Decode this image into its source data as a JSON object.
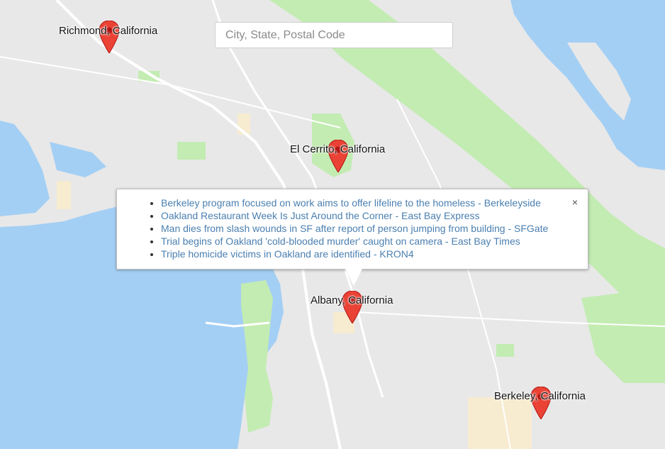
{
  "search": {
    "placeholder": "City, State, Postal Code",
    "value": ""
  },
  "markers": [
    {
      "label": "Richmond, California"
    },
    {
      "label": "El Cerrito, California"
    },
    {
      "label": "Albany, California"
    },
    {
      "label": "Berkeley, California"
    }
  ],
  "popup": {
    "close_label": "×",
    "items": [
      {
        "text": "Berkeley program focused on work aims to offer lifeline to the homeless - Berkeleyside"
      },
      {
        "text": "Oakland Restaurant Week Is Just Around the Corner - East Bay Express"
      },
      {
        "text": "Man dies from slash wounds in SF after report of person jumping from building - SFGate"
      },
      {
        "text": "Trial begins of Oakland 'cold-blooded murder' caught on camera - East Bay Times"
      },
      {
        "text": "Triple homicide victims in Oakland are identified - KRON4"
      }
    ]
  },
  "colors": {
    "land": "#e8e8e8",
    "water": "#a4cff4",
    "park": "#c3ecb2",
    "urban": "#f7ebd0",
    "road": "#ffffff",
    "marker": "#ea4335",
    "link": "#4a7fb0"
  }
}
